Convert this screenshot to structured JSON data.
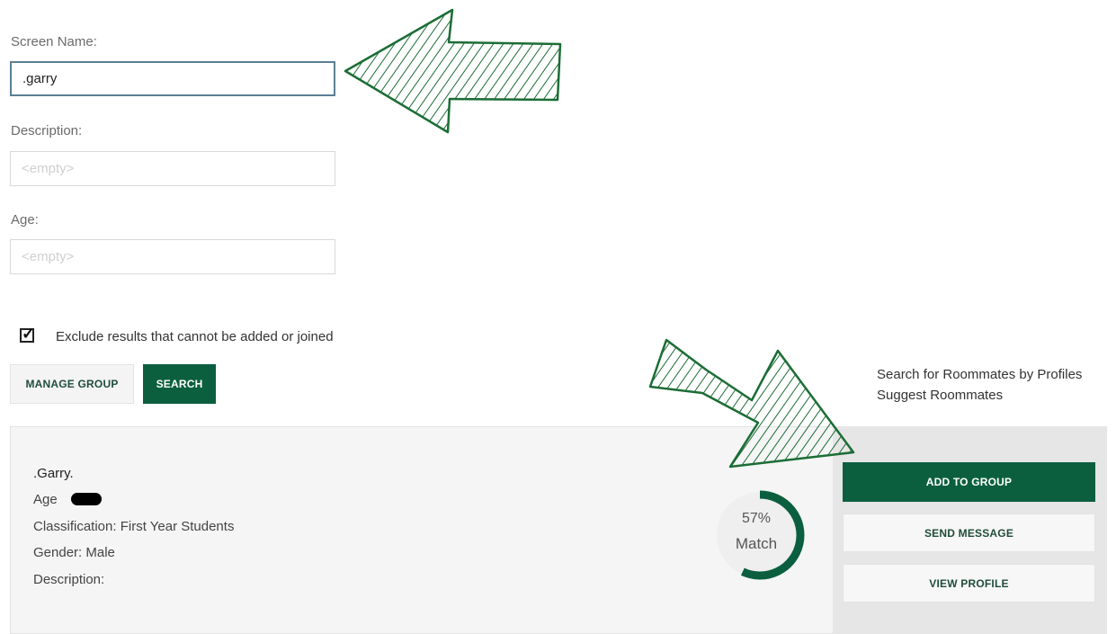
{
  "form": {
    "screen_name_label": "Screen Name:",
    "screen_name_value": ".garry",
    "description_label": "Description:",
    "description_placeholder": "<empty>",
    "age_label": "Age:",
    "age_placeholder": "<empty>"
  },
  "exclude": {
    "label": "Exclude results that cannot be added or joined",
    "checked": true
  },
  "buttons": {
    "manage_group": "MANAGE GROUP",
    "search": "SEARCH"
  },
  "links": {
    "search_by_profiles": "Search for Roommates by Profiles",
    "suggest": "Suggest Roommates"
  },
  "result": {
    "name": ".Garry.",
    "age_label": "Age",
    "classification": "Classification: First Year Students",
    "gender": "Gender: Male",
    "description": "Description:",
    "match_percent_text": "57%",
    "match_label": "Match",
    "match_value": 0.57,
    "add_to_group": "ADD TO GROUP",
    "send_message": "SEND MESSAGE",
    "view_profile": "VIEW PROFILE"
  },
  "colors": {
    "brand_green": "#0b5f3f",
    "annotation_green": "#1b6d35"
  },
  "annotations": [
    {
      "type": "hatched-arrow",
      "direction": "left",
      "target": "screen-name-input"
    },
    {
      "type": "hatched-arrow",
      "direction": "down-right",
      "target": "add-to-group-button"
    }
  ]
}
